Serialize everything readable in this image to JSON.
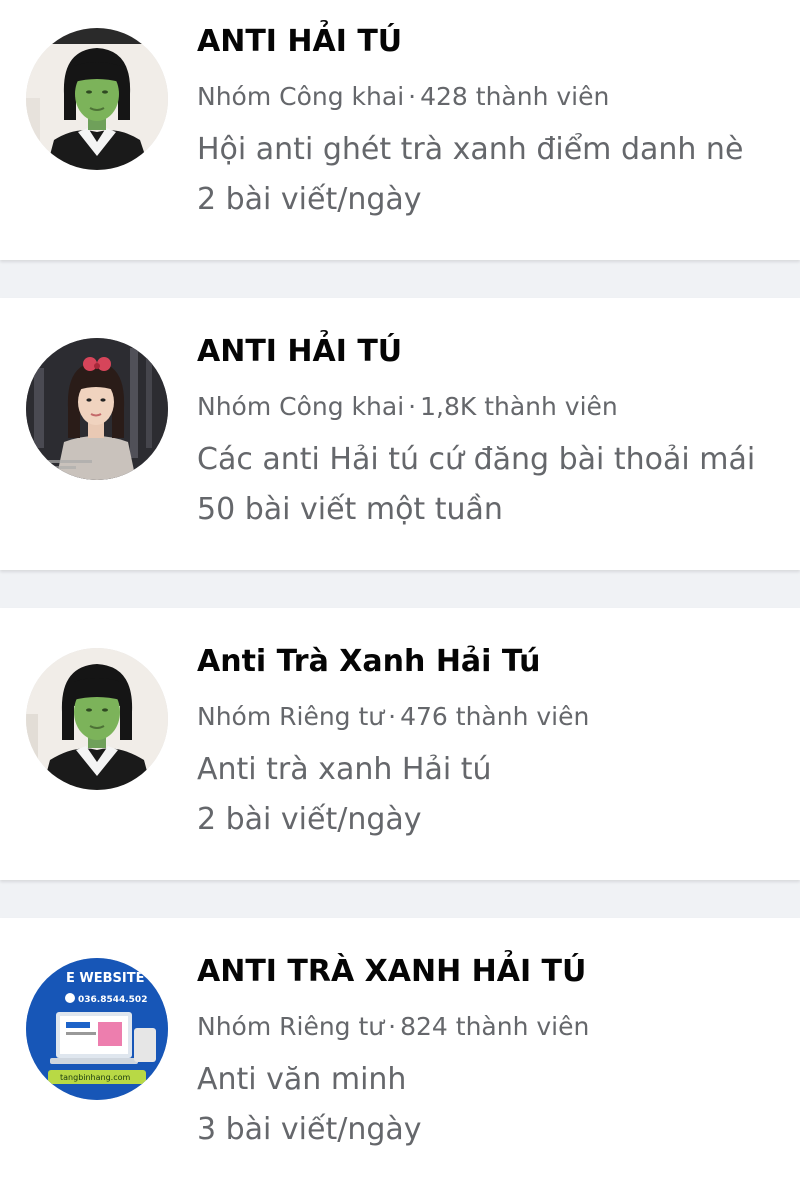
{
  "groups": [
    {
      "name": "ANTI HẢI TÚ",
      "privacy": "Nhóm Công khai",
      "members": "428 thành viên",
      "description": "Hội anti ghét trà xanh điểm danh nè",
      "activity": "2 bài viết/ngày",
      "avatar": "green-face-girl-photo"
    },
    {
      "name": "ANTI HẢI TÚ",
      "privacy": "Nhóm Công khai",
      "members": "1,8K thành viên",
      "description": "Các anti Hải tú cứ đăng bài thoải mái",
      "activity": "50 bài viết một tuần",
      "avatar": "girl-portrait-photo"
    },
    {
      "name": "Anti Trà Xanh Hải Tú",
      "privacy": "Nhóm Riêng tư",
      "members": "476 thành viên",
      "description": "Anti trà xanh Hải tú",
      "activity": "2 bài viết/ngày",
      "avatar": "green-face-girl-photo"
    },
    {
      "name": "ANTI TRÀ XANH HẢI TÚ",
      "privacy": "Nhóm Riêng tư",
      "members": "824 thành viên",
      "description": "Anti văn minh",
      "activity": "3 bài viết/ngày",
      "avatar": "website-ad-image",
      "avatar_text": {
        "banner": "E WEBSITE",
        "phone": "036.8544.502",
        "footer": "tangbinhang.com"
      }
    }
  ],
  "separator": "·"
}
